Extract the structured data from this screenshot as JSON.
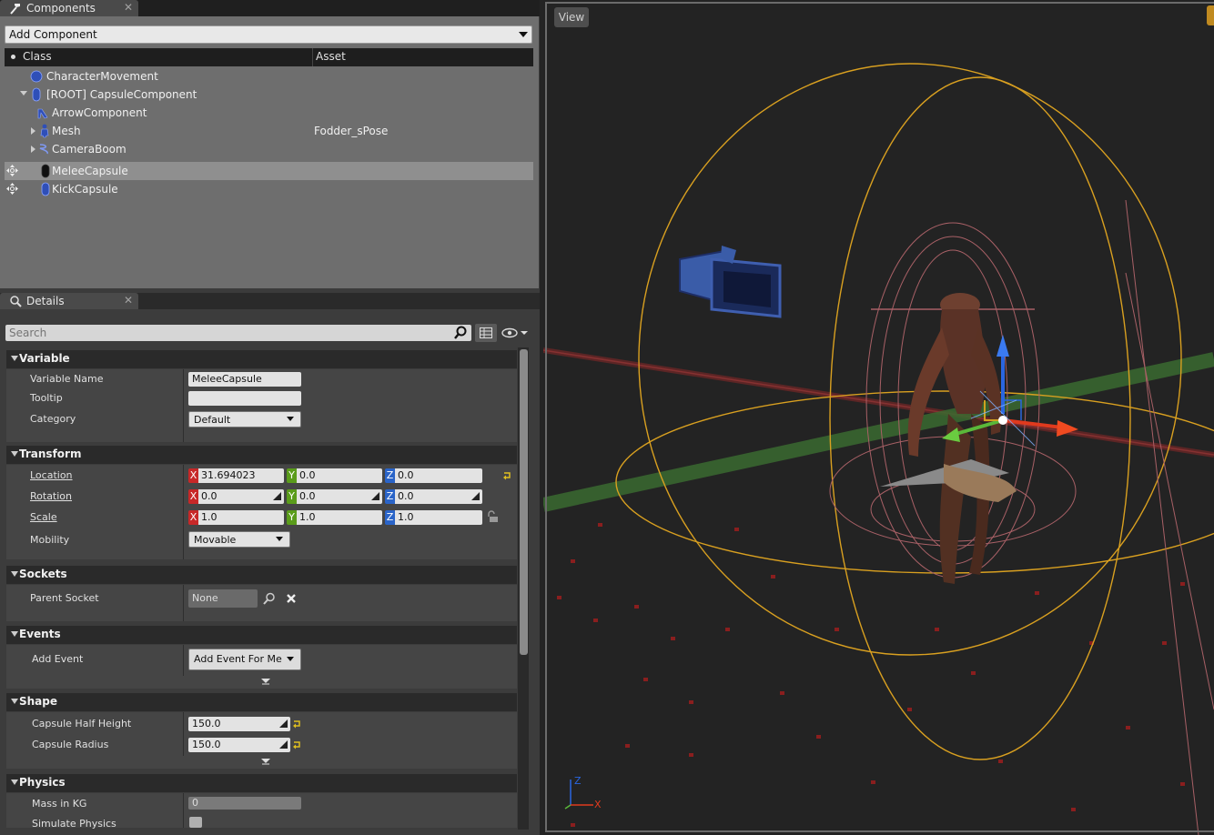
{
  "components_panel": {
    "tab_title": "Components",
    "add_component_label": "Add Component",
    "columns": {
      "class": "Class",
      "asset": "Asset"
    },
    "items": [
      {
        "label": "CharacterMovement",
        "asset": ""
      },
      {
        "label": "[ROOT] CapsuleComponent",
        "asset": ""
      },
      {
        "label": "ArrowComponent",
        "asset": ""
      },
      {
        "label": "Mesh",
        "asset": "Fodder_sPose"
      },
      {
        "label": "CameraBoom",
        "asset": ""
      },
      {
        "label": "MeleeCapsule",
        "asset": ""
      },
      {
        "label": "KickCapsule",
        "asset": ""
      }
    ]
  },
  "details_panel": {
    "tab_title": "Details",
    "search_placeholder": "Search",
    "variable": {
      "title": "Variable",
      "name_label": "Variable Name",
      "name_value": "MeleeCapsule",
      "tooltip_label": "Tooltip",
      "tooltip_value": "",
      "category_label": "Category",
      "category_value": "Default"
    },
    "transform": {
      "title": "Transform",
      "location_label": "Location",
      "location": {
        "x": "31.694023",
        "y": "0.0",
        "z": "0.0"
      },
      "rotation_label": "Rotation",
      "rotation": {
        "x": "0.0",
        "y": "0.0",
        "z": "0.0"
      },
      "scale_label": "Scale",
      "scale": {
        "x": "1.0",
        "y": "1.0",
        "z": "1.0"
      },
      "mobility_label": "Mobility",
      "mobility_value": "Movable",
      "axis_x": "X",
      "axis_y": "Y",
      "axis_z": "Z"
    },
    "sockets": {
      "title": "Sockets",
      "parent_socket_label": "Parent Socket",
      "parent_socket_value": "None"
    },
    "events": {
      "title": "Events",
      "add_event_label": "Add Event",
      "add_event_button": "Add Event For Melee"
    },
    "shape": {
      "title": "Shape",
      "half_height_label": "Capsule Half Height",
      "half_height_value": "150.0",
      "radius_label": "Capsule Radius",
      "radius_value": "150.0"
    },
    "physics": {
      "title": "Physics",
      "mass_label": "Mass in KG",
      "mass_value": "0",
      "simulate_label": "Simulate Physics"
    }
  },
  "viewport": {
    "view_button": "View",
    "axis_labels": {
      "x": "X",
      "z": "Z"
    }
  },
  "colors": {
    "capsule_orange": "#e0a020",
    "capsule_pink": "#b06a70",
    "selection_highlight": "#8f8f8f"
  }
}
